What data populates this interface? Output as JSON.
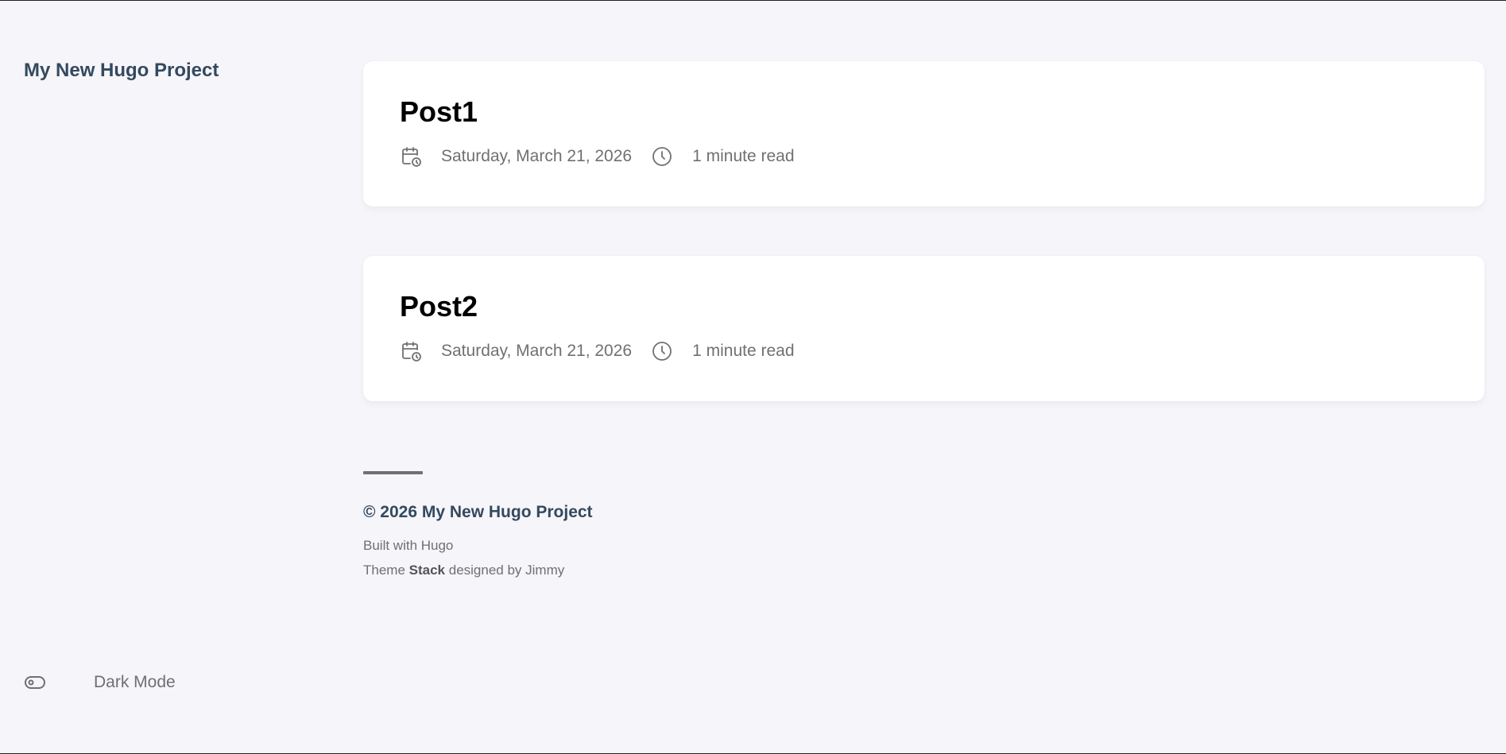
{
  "site": {
    "name": "My New Hugo Project"
  },
  "sidebar": {
    "dark_mode_label": "Dark Mode",
    "dark_mode_icon": "toggle-icon"
  },
  "posts": [
    {
      "title": "Post1",
      "date": "Saturday, March 21, 2026",
      "read_time": "1 minute read",
      "date_icon": "calendar-clock-icon",
      "time_icon": "clock-icon"
    },
    {
      "title": "Post2",
      "date": "Saturday, March 21, 2026",
      "read_time": "1 minute read",
      "date_icon": "calendar-clock-icon",
      "time_icon": "clock-icon"
    }
  ],
  "footer": {
    "copyright": "© 2026 My New Hugo Project",
    "built_with_prefix": "Built with ",
    "built_with_link": "Hugo",
    "theme_prefix": "Theme ",
    "theme_name": "Stack",
    "theme_middle": " designed by ",
    "theme_author": "Jimmy"
  },
  "colors": {
    "background": "#f5f5fa",
    "card": "#ffffff",
    "text_primary": "#34495e",
    "text_secondary": "#707070",
    "title": "#000000"
  }
}
